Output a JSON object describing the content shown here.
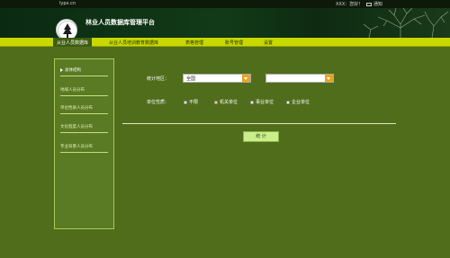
{
  "topbar": {
    "domain": "lypx.cn",
    "greeting": "XXX：您好！",
    "notify_label": "通知"
  },
  "header": {
    "title": "林业人员数据库管理平台"
  },
  "nav": {
    "tabs": [
      {
        "label": "从业人员数据库",
        "active": true
      },
      {
        "label": "从业人员培训教育数据库",
        "active": false
      },
      {
        "label": "表格管理",
        "active": false
      },
      {
        "label": "账号管理",
        "active": false
      },
      {
        "label": "设置",
        "active": false
      }
    ]
  },
  "sidebar": {
    "items": [
      {
        "label": "总体结构"
      },
      {
        "label": "地域人员分布"
      },
      {
        "label": "单位性质人员分布"
      },
      {
        "label": "文化程度人员分布"
      },
      {
        "label": "专业背景人员分布"
      }
    ]
  },
  "filters": {
    "region_label": "统计地区：",
    "region_select1": "全国",
    "region_select2": "",
    "unit_label": "单位性质：",
    "checkboxes": [
      {
        "label": "不限",
        "checked": false
      },
      {
        "label": "机关单位",
        "checked": true
      },
      {
        "label": "事业单位",
        "checked": false
      },
      {
        "label": "企业单位",
        "checked": false
      }
    ]
  },
  "actions": {
    "stats_button": "统 计"
  },
  "colors": {
    "background": "#4f6d1b",
    "nav_bar": "#c8d800",
    "select_arrow": "#e9a320",
    "button": "#c9ee8b"
  }
}
